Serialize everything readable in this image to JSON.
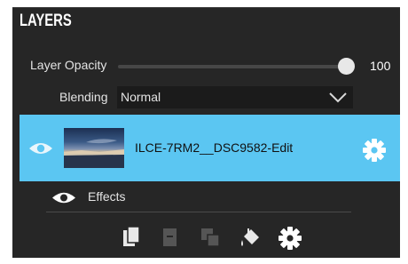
{
  "panel": {
    "title": "LAYERS"
  },
  "opacity": {
    "label": "Layer Opacity",
    "value": "100",
    "level_percent": 100
  },
  "blending": {
    "label": "Blending",
    "value": "Normal"
  },
  "layer": {
    "name": "ILCE-7RM2__DSC9582-Edit",
    "visible": true,
    "thumbnail": "blue-hour-landscape-photo"
  },
  "effects": {
    "label": "Effects",
    "visible": true
  },
  "toolbar": {
    "icons": [
      "duplicate-layer-icon",
      "delete-layer-icon",
      "merge-layers-icon",
      "fill-bucket-icon",
      "settings-gear-icon"
    ]
  },
  "colors": {
    "panel_bg": "#262626",
    "selected_row": "#5bc6f2",
    "text": "#e4e4e4"
  }
}
